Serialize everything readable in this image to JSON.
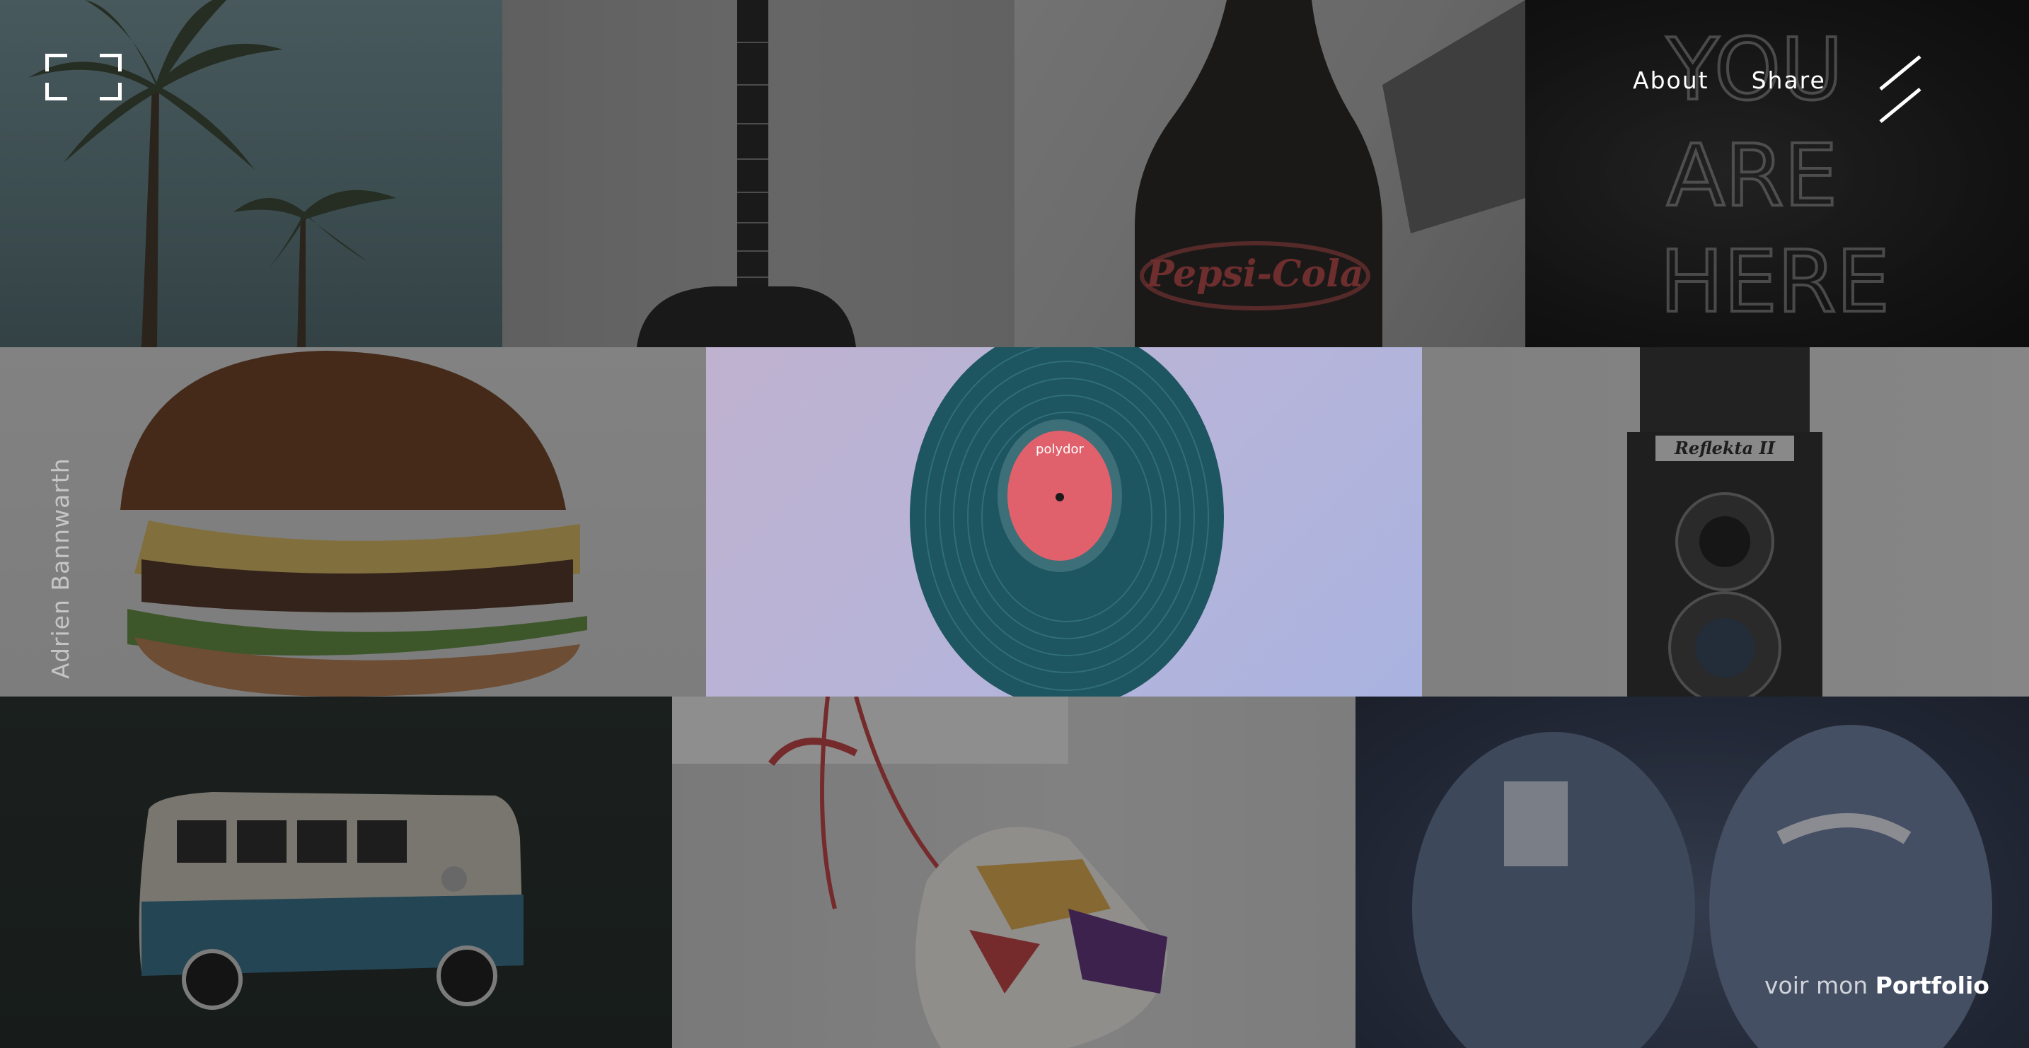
{
  "header": {
    "logo_icon": "frame-corners-icon",
    "nav": [
      {
        "label": "About"
      },
      {
        "label": "Share"
      }
    ],
    "menu_icon": "double-slash-menu-icon"
  },
  "sidebar": {
    "author_name": "Adrien Bannwarth"
  },
  "footer": {
    "cta_prefix": "voir mon",
    "cta_link": "Portfolio"
  },
  "gallery": {
    "tiles": [
      {
        "id": "palm",
        "subject": "palm trees"
      },
      {
        "id": "guitar",
        "subject": "acoustic guitar"
      },
      {
        "id": "bottle",
        "subject": "pepsi-cola bottle",
        "label_text": "Pepsi-Cola"
      },
      {
        "id": "neon",
        "subject": "neon sign",
        "label_text": "YOU ARE HERE"
      },
      {
        "id": "burger",
        "subject": "burger"
      },
      {
        "id": "vinyl",
        "subject": "vinyl record",
        "active": true,
        "label_text": "polydor"
      },
      {
        "id": "camera",
        "subject": "twin lens camera",
        "label_text": "Reflekta II"
      },
      {
        "id": "van",
        "subject": "toy vw van"
      },
      {
        "id": "shoe",
        "subject": "hanging sneaker"
      },
      {
        "id": "snow",
        "subject": "snowy boots"
      }
    ]
  },
  "colors": {
    "overlay_text": "#ffffff",
    "vinyl_label": "#e0616b",
    "vinyl_disc": "#1d5560",
    "neon": "#dcdcdc"
  }
}
